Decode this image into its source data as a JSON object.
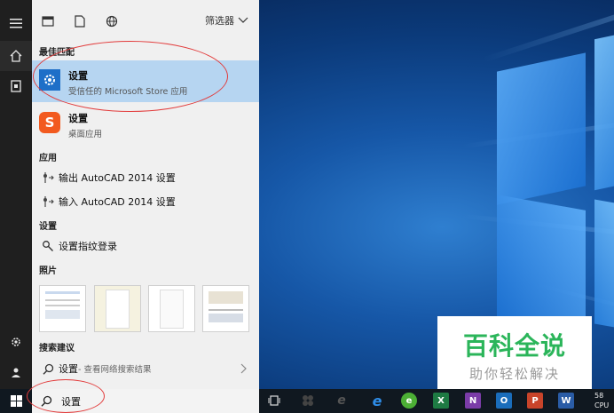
{
  "panel": {
    "filter_label": "筛选器",
    "sections": {
      "best_match": "最佳匹配",
      "apps": "应用",
      "settings": "设置",
      "photos": "照片",
      "search_suggestions": "搜索建议"
    },
    "best_match": {
      "title": "设置",
      "subtitle": "受信任的 Microsoft Store 应用"
    },
    "second_match": {
      "title": "设置",
      "subtitle": "桌面应用"
    },
    "apps": [
      {
        "label": "输出 AutoCAD 2014 设置"
      },
      {
        "label": "输入 AutoCAD 2014 设置"
      }
    ],
    "settings_items": [
      {
        "label": "设置指纹登录"
      }
    ],
    "suggestion": {
      "term": "设置",
      "hint": " - 查看网络搜索结果"
    }
  },
  "taskbar": {
    "search_value": "设置",
    "tray_line1": "58",
    "tray_line2": "CPU"
  },
  "watermark": {
    "title": "百科全说",
    "subtitle": "助你轻松解决"
  },
  "colors": {
    "panel_bg": "#f0f0f0",
    "rail_bg": "#1f1f1f",
    "highlight": "#b6d5f1",
    "settings_blue": "#1e6fc8",
    "sogou_orange": "#f25a1f",
    "watermark_green": "#2bb55a",
    "annotation_red": "#e23b3b"
  }
}
